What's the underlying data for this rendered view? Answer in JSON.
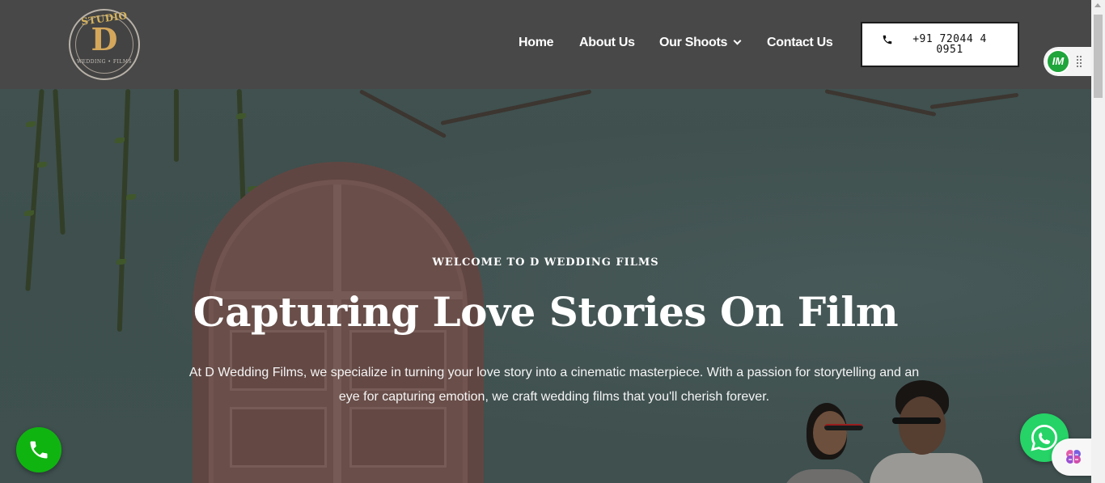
{
  "brand": {
    "logo_top": "STUDIO",
    "logo_letter": "D",
    "logo_bottom": "WEDDING • FILMS"
  },
  "nav": {
    "items": [
      {
        "label": "Home"
      },
      {
        "label": "About Us"
      },
      {
        "label": "Our Shoots",
        "has_dropdown": true
      },
      {
        "label": "Contact Us"
      }
    ]
  },
  "contact": {
    "phone": "+91 72044 40951",
    "phone_icon": "phone-icon"
  },
  "widgets": {
    "im_label": "IM",
    "call_icon": "phone-icon",
    "whatsapp_icon": "whatsapp-icon",
    "assistant_icon": "brain-icon"
  },
  "hero": {
    "eyebrow": "WELCOME TO D WEDDING FILMS",
    "headline": "Capturing Love Stories On Film",
    "paragraph": "At D Wedding Films, we specialize in turning your love story into a cinematic masterpiece. With a passion for storytelling and an eye for capturing emotion, we craft wedding films that you'll cherish forever."
  },
  "colors": {
    "header_bg": "#484848",
    "call_green": "#10b410",
    "whatsapp_green": "#25d366",
    "logo_gold": "#d4a75b"
  }
}
